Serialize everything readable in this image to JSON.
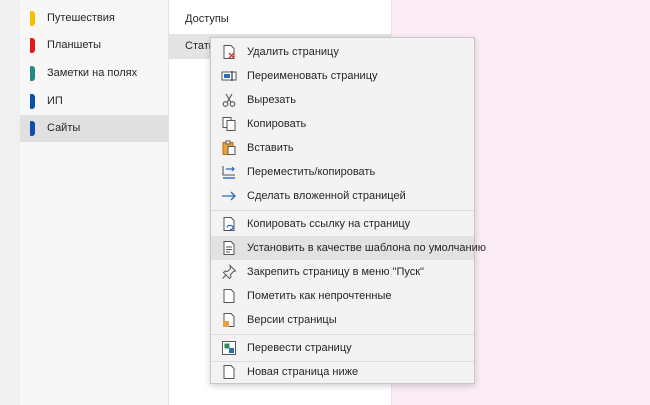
{
  "sections": {
    "items": [
      {
        "label": "Путешествия",
        "color": "#f2c200"
      },
      {
        "label": "Планшеты",
        "color": "#e01b1b"
      },
      {
        "label": "Заметки на полях",
        "color": "#1e8a84"
      },
      {
        "label": "ИП",
        "color": "#0d4fa8"
      },
      {
        "label": "Сайты",
        "color": "#0d4fa8",
        "selected": true
      }
    ]
  },
  "pages": {
    "items": [
      {
        "label": "Доступы"
      },
      {
        "label": "Стать",
        "selected": true
      }
    ]
  },
  "context_menu": {
    "items": [
      {
        "label": "Удалить страницу",
        "icon": "delete-page-icon"
      },
      {
        "label": "Переименовать страницу",
        "icon": "rename-page-icon"
      },
      {
        "label": "Вырезать",
        "icon": "scissors-icon"
      },
      {
        "label": "Копировать",
        "icon": "copy-icon"
      },
      {
        "label": "Вставить",
        "icon": "paste-icon"
      },
      {
        "label": "Переместить/копировать",
        "icon": "move-copy-icon"
      },
      {
        "label": "Сделать вложенной страницей",
        "icon": "arrow-right-icon"
      },
      {
        "label": "Копировать ссылку на страницу",
        "icon": "page-link-icon"
      },
      {
        "label": "Установить в качестве шаблона по умолчанию",
        "icon": "template-icon",
        "hover": true
      },
      {
        "label": "Закрепить страницу в меню \"Пуск\"",
        "icon": "pin-icon"
      },
      {
        "label": "Пометить как непрочтенные",
        "icon": "mark-unread-icon"
      },
      {
        "label": "Версии страницы",
        "icon": "page-versions-icon"
      },
      {
        "label": "Перевести страницу",
        "icon": "translate-icon"
      },
      {
        "label": "Новая страница ниже",
        "icon": "new-page-icon"
      }
    ]
  }
}
